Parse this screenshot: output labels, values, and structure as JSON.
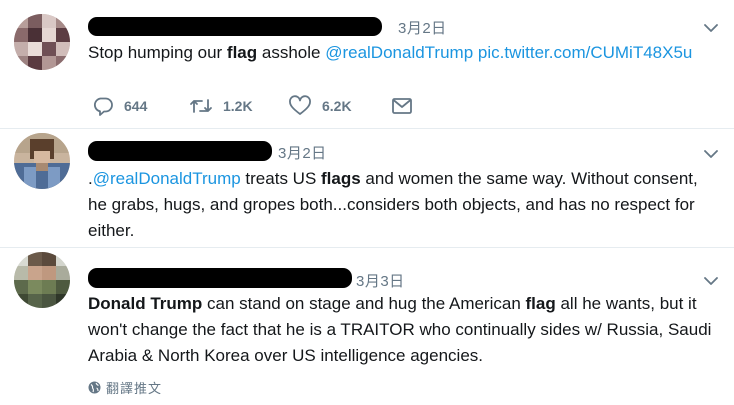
{
  "tweets": [
    {
      "date": "3月2日",
      "text_parts": [
        {
          "t": "Stop humping our ",
          "s": "plain"
        },
        {
          "t": "flag",
          "s": "bold"
        },
        {
          "t": " asshole ",
          "s": "plain"
        },
        {
          "t": "@realDonaldTrump",
          "s": "mention"
        },
        {
          "t": " ",
          "s": "plain"
        },
        {
          "t": "pic.twitter.com/CUMiT48X5u",
          "s": "link"
        }
      ],
      "actions": {
        "reply_icon": "reply-icon",
        "reply_count": "644",
        "retweet_icon": "retweet-icon",
        "retweet_count": "1.2K",
        "like_icon": "heart-icon",
        "like_count": "6.2K",
        "dm_icon": "envelope-icon"
      }
    },
    {
      "date": "3月2日",
      "lines": [
        [
          {
            "t": ".",
            "s": "plain"
          },
          {
            "t": "@realDonaldTrump",
            "s": "mention"
          },
          {
            "t": " treats US ",
            "s": "plain"
          },
          {
            "t": "flags",
            "s": "bold"
          },
          {
            "t": " and women the same way. Without consent,",
            "s": "plain"
          }
        ],
        [
          {
            "t": "he grabs, hugs, and gropes both...considers both objects, and has no respect for",
            "s": "plain"
          }
        ],
        [
          {
            "t": "either.",
            "s": "plain"
          }
        ]
      ]
    },
    {
      "date": "3月3日",
      "lines": [
        [
          {
            "t": "Donald Trump",
            "s": "bold"
          },
          {
            "t": " can stand on stage and hug the American ",
            "s": "plain"
          },
          {
            "t": "flag",
            "s": "bold"
          },
          {
            "t": " all he wants, but it",
            "s": "plain"
          }
        ],
        [
          {
            "t": "won't change the fact that he is a TRAITOR who continually sides w/ Russia, Saudi",
            "s": "plain"
          }
        ],
        [
          {
            "t": "Arabia & North Korea over US intelligence agencies.",
            "s": "plain"
          }
        ]
      ],
      "translate_label": "翻譯推文",
      "translate_icon": "globe-icon"
    }
  ],
  "colors": {
    "link": "#1b95e0",
    "meta": "#657786",
    "divider": "#e6ecf0"
  }
}
